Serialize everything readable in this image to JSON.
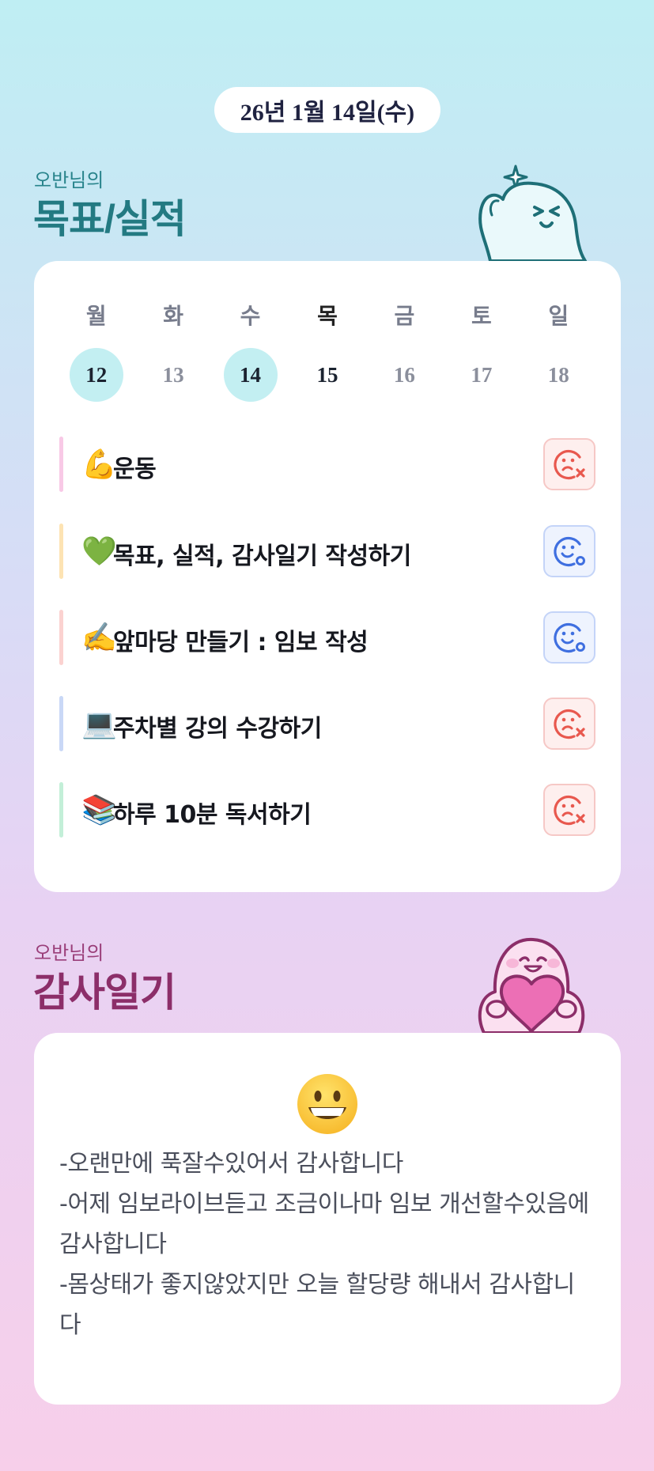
{
  "date_label": "26년 1월 14일(수)",
  "goals_section": {
    "subtitle": "오반님의",
    "title": "목표/실적"
  },
  "week": {
    "days": [
      {
        "name": "월",
        "date": "12"
      },
      {
        "name": "화",
        "date": "13"
      },
      {
        "name": "수",
        "date": "14"
      },
      {
        "name": "목",
        "date": "15"
      },
      {
        "name": "금",
        "date": "16"
      },
      {
        "name": "토",
        "date": "17"
      },
      {
        "name": "일",
        "date": "18"
      }
    ]
  },
  "goals": [
    {
      "icon": "💪",
      "text": "운동",
      "bar_color": "#f8c9e6",
      "status": "fail"
    },
    {
      "icon": "💚",
      "text": "목표, 실적, 감사일기 작성하기",
      "bar_color": "#fde3b3",
      "status": "success"
    },
    {
      "icon": "✍️",
      "text": "앞마당 만들기 : 임보 작성",
      "bar_color": "#fbd2d0",
      "status": "success"
    },
    {
      "icon": "💻",
      "text": "주차별 강의 수강하기",
      "bar_color": "#c9d8f6",
      "status": "fail"
    },
    {
      "icon": "📚",
      "text": "하루 10분 독서하기",
      "bar_color": "#c3efd8",
      "status": "fail"
    }
  ],
  "gratitude_section": {
    "subtitle": "오반님의",
    "title": "감사일기"
  },
  "gratitude": {
    "mood": "grinning-face",
    "text": "-오랜만에 푹잘수있어서 감사합니다\n-어제 임보라이브듣고 조금이나마 임보 개선할수있음에 감사합니다\n-몸상태가 좋지않았지만 오늘 할당량 해내서 감사합니다"
  },
  "colors": {
    "goal_title": "#237a82",
    "gratitude_title": "#8c2e69",
    "done_day_highlight": "#c3eff2",
    "fail_status": "#e8584e",
    "success_status": "#3f6fe0"
  }
}
